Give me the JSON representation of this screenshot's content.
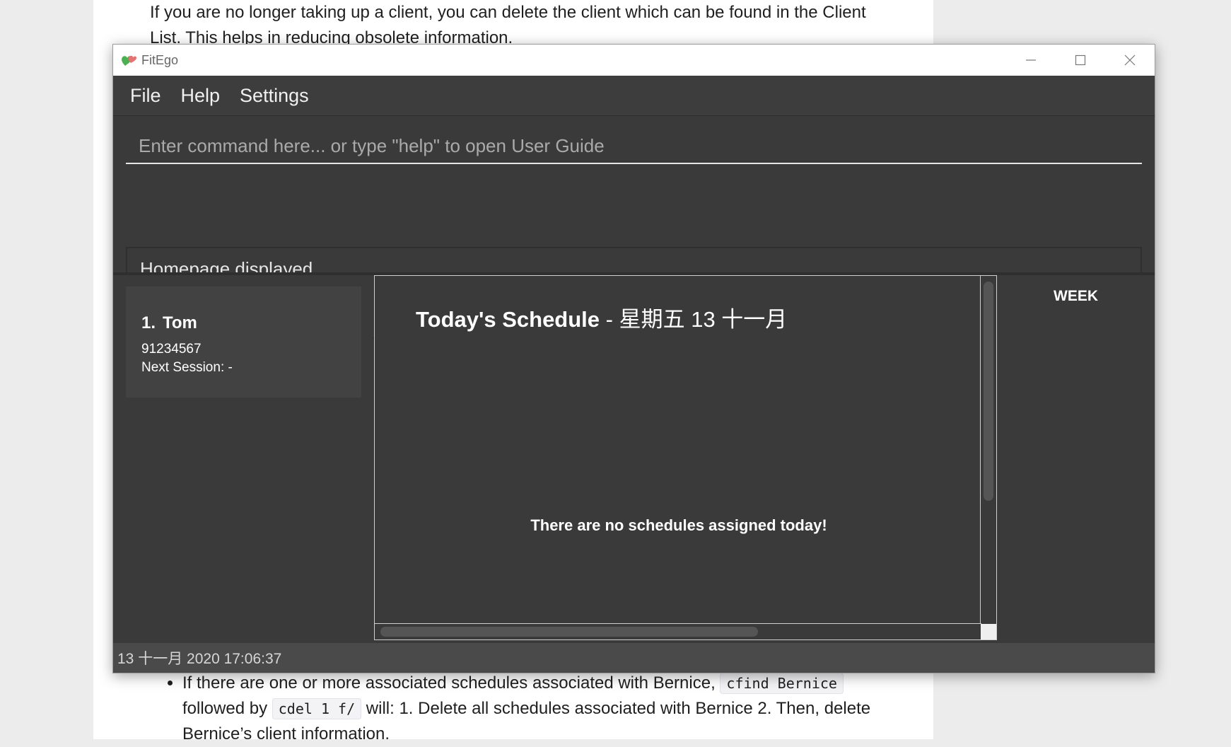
{
  "document": {
    "top_paragraph": "If you are no longer taking up a client, you can delete the client which can be found in the Client List. This helps in reducing obsolete information.",
    "bullet_before_code1": "If there are one or more associated schedules associated with Bernice, ",
    "code1": "cfind Bernice",
    "bullet_mid": " followed by ",
    "code2": "cdel 1 f/",
    "bullet_after_code2": " will: 1. Delete all schedules associated with Bernice 2. Then, delete Bernice’s client information."
  },
  "window": {
    "title": "FitEgo",
    "icon": "heart-app-icon"
  },
  "menu": {
    "file": "File",
    "help": "Help",
    "settings": "Settings"
  },
  "command": {
    "placeholder": "Enter command here... or type \"help\" to open User Guide",
    "value": ""
  },
  "result": {
    "message": "Homepage displayed."
  },
  "clients": [
    {
      "index": "1.",
      "name": "Tom",
      "phone": "91234567",
      "next_session": "Next Session:  -"
    }
  ],
  "schedule": {
    "title_bold": "Today's Schedule",
    "title_rest": " - 星期五 13 十一月",
    "empty_message": "There are no schedules assigned today!"
  },
  "week": {
    "label": "WEEK"
  },
  "status": {
    "datetime": "13 十一月 2020 17:06:37"
  },
  "colors": {
    "window_bg": "#3a3a3a",
    "menubar_bg": "#3d3d3d",
    "statusbar_bg": "#4a4a4a",
    "text": "#ffffff"
  }
}
